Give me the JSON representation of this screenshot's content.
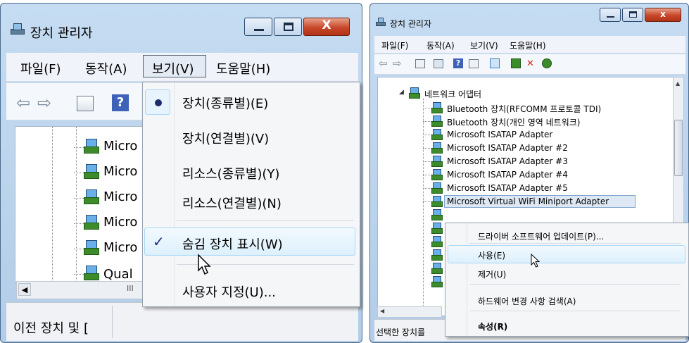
{
  "left_window": {
    "title": "장치 관리자",
    "menu": {
      "file": "파일(F)",
      "action": "동작(A)",
      "view": "보기(V)",
      "help": "도움말(H)"
    },
    "tree_items": [
      "Micro",
      "Micro",
      "Micro",
      "Micro",
      "Micro",
      "Qual"
    ],
    "scroll_mark": "III",
    "status_text": "이전 장치 및 [",
    "view_menu": {
      "items": [
        {
          "label": "장치(종류별)(E)",
          "mark": "bullet"
        },
        {
          "label": "장치(연결별)(V)",
          "mark": ""
        },
        {
          "label": "리소스(종류별)(Y)",
          "mark": ""
        },
        {
          "label": "리소스(연결별)(N)",
          "mark": ""
        },
        {
          "label": "숨김 장치 표시(W)",
          "mark": "check"
        },
        {
          "label": "사용자 지정(U)...",
          "mark": ""
        }
      ]
    }
  },
  "right_window": {
    "title": "장치 관리자",
    "menu": {
      "file": "파일(F)",
      "action": "동작(A)",
      "view": "보기(V)",
      "help": "도움말(H)"
    },
    "tree": {
      "category": "네트워크 어댑터",
      "items": [
        "Bluetooth 장치(RFCOMM 프로토콜 TDI)",
        "Bluetooth 장치(개인 영역 네트워크)",
        "Microsoft ISATAP Adapter",
        "Microsoft ISATAP Adapter #2",
        "Microsoft ISATAP Adapter #3",
        "Microsoft ISATAP Adapter #4",
        "Microsoft ISATAP Adapter #5",
        "Microsoft Virtual WiFi Miniport Adapter"
      ]
    },
    "context_menu": {
      "update_driver": "드라이버 소프트웨어 업데이트(P)...",
      "enable": "사용(E)",
      "uninstall": "제거(U)",
      "scan_hardware": "하드웨어 변경 사항 검색(A)",
      "properties": "속성(R)"
    },
    "status_text": "선택한 장치를"
  },
  "colors": {
    "title_bar": "#c5dcf2",
    "close_button": "#c8472a",
    "hover_highlight": "#ddf0fc",
    "netcard_green": "#3c8c2c"
  }
}
